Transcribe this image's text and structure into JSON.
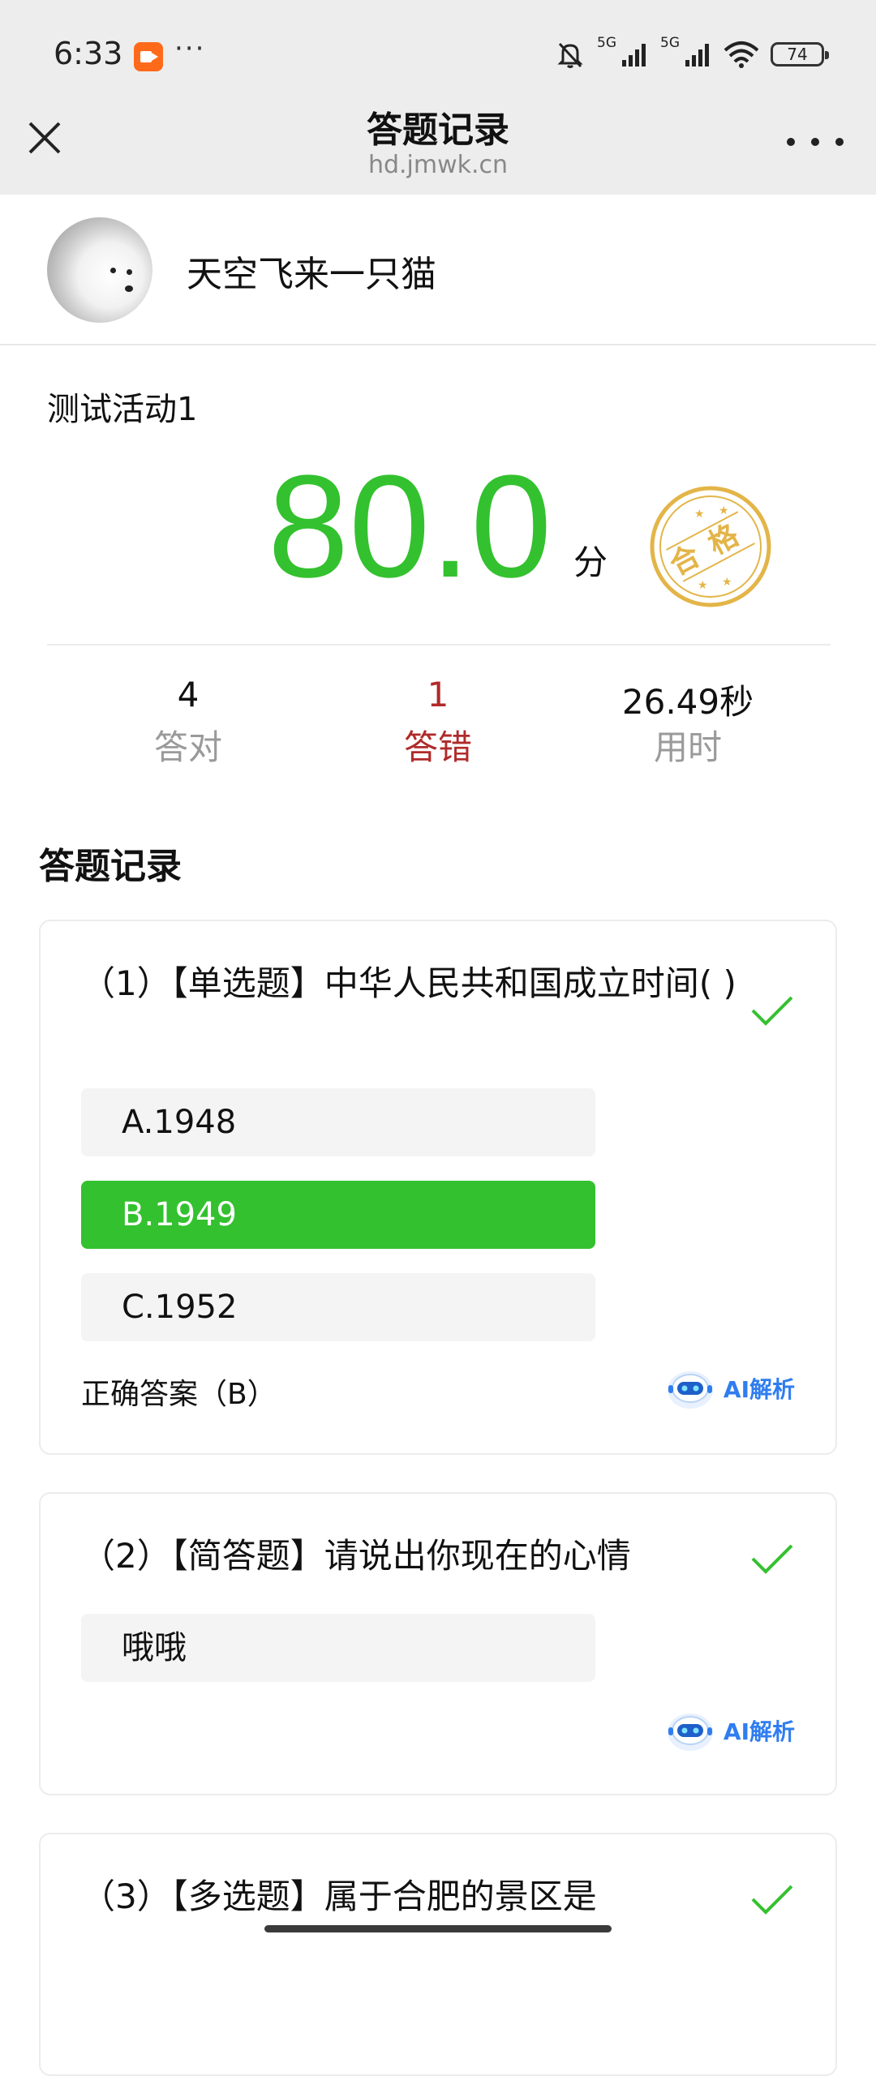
{
  "status_bar": {
    "time": "6:33",
    "more": "···",
    "signal_1_label": "5G",
    "signal_2_label": "5G",
    "battery": "74"
  },
  "header": {
    "title": "答题记录",
    "domain": "hd.jmwk.cn"
  },
  "user": {
    "name": "天空飞来一只猫"
  },
  "activity": {
    "title": "测试活动1",
    "score": "80.0",
    "score_unit": "分",
    "stamp_text": "合格",
    "stats": [
      {
        "value": "4",
        "label": "答对"
      },
      {
        "value": "1",
        "label": "答错"
      },
      {
        "value": "26.49秒",
        "label": "用时"
      }
    ]
  },
  "records_heading": "答题记录",
  "questions": [
    {
      "title": "（1）【单选题】中华人民共和国成立时间( )",
      "options": [
        "A.1948",
        "B.1949",
        "C.1952"
      ],
      "selected_index": 1,
      "correct_answer": "正确答案（B）",
      "ai_label": "AI解析"
    },
    {
      "title": "（2）【简答题】请说出你现在的心情",
      "answer": "哦哦",
      "ai_label": "AI解析"
    },
    {
      "title": "（3）【多选题】属于合肥的景区是"
    }
  ],
  "colors": {
    "score_green": "#34c12f",
    "wrong_red": "#b02a2a",
    "stamp_gold": "#e3b548",
    "ai_blue": "#2f7df0"
  }
}
